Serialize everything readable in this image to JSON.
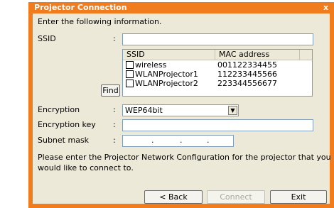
{
  "window": {
    "title": "Projector Connection",
    "close_glyph": "x"
  },
  "intro_text": "Enter the following information.",
  "fields": {
    "ssid": {
      "label": "SSID",
      "colon": ":",
      "value": ""
    },
    "encryption": {
      "label": "Encryption",
      "colon": ":",
      "selected": "WEP64bit"
    },
    "encryption_key": {
      "label": "Encryption key",
      "colon": ":",
      "value": ""
    },
    "subnet_mask": {
      "label": "Subnet mask",
      "colon": ":",
      "dots": [
        ".",
        ".",
        "."
      ]
    }
  },
  "ssid_list": {
    "columns": [
      "SSID",
      "MAC address"
    ],
    "rows": [
      {
        "ssid": "wireless",
        "mac": "001122334455",
        "checked": false
      },
      {
        "ssid": "WLANProjector1",
        "mac": "112233445566",
        "checked": false
      },
      {
        "ssid": "WLANProjector2",
        "mac": "223344556677",
        "checked": false
      }
    ]
  },
  "find_button": "Find",
  "instruction_text_1": "Please enter the Projector Network Configuration for the projector that you",
  "instruction_text_2": "would like to connect to.",
  "buttons": {
    "back": "< Back",
    "connect": "Connect",
    "exit": "Exit"
  },
  "colors": {
    "frame": "#f07c1e",
    "client": "#ece9d8",
    "input_border": "#7f9db9"
  },
  "icons": {
    "close": "close-icon",
    "dropdown": "chevron-down-icon"
  }
}
